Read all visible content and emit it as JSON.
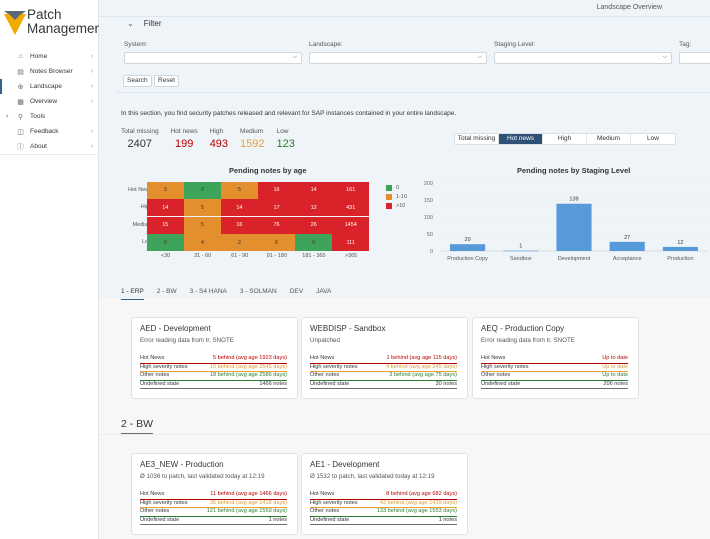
{
  "app": {
    "title_line1": "Patch",
    "title_line2": "Management",
    "brand_colors": {
      "orange": "#f0ab00",
      "dark": "#5e6a73"
    }
  },
  "sidebar": {
    "items": [
      {
        "label": "Home",
        "icon": "home-icon",
        "glyph": "⌂",
        "active": false,
        "expandable": false
      },
      {
        "label": "Notes Browser",
        "icon": "notes-icon",
        "glyph": "▤",
        "active": false,
        "expandable": false
      },
      {
        "label": "Landscape",
        "icon": "globe-icon",
        "glyph": "⊕",
        "active": true,
        "expandable": false
      },
      {
        "label": "Overview",
        "icon": "grid-icon",
        "glyph": "▦",
        "active": false,
        "expandable": false
      },
      {
        "label": "Tools",
        "icon": "wrench-icon",
        "glyph": "⚲",
        "active": false,
        "expandable": true
      },
      {
        "label": "Feedback",
        "icon": "feedback-icon",
        "glyph": "◫",
        "active": false,
        "expandable": false
      },
      {
        "label": "About",
        "icon": "info-icon",
        "glyph": "ⓘ",
        "active": false,
        "expandable": false
      }
    ]
  },
  "header": {
    "title": "Landscape Overview"
  },
  "filter": {
    "title": "Filter",
    "fields": [
      {
        "label": "System:",
        "value": ""
      },
      {
        "label": "Landscape:",
        "value": ""
      },
      {
        "label": "Staging Level:",
        "value": ""
      },
      {
        "label": "Tag:",
        "value": ""
      }
    ],
    "search_label": "Search",
    "reset_label": "Reset"
  },
  "intro": "In this section, you find security patches released and relevant for SAP instances contained in your entire landscape.",
  "kpis": [
    {
      "label": "Total missing",
      "value": "2407",
      "color": "#32363a"
    },
    {
      "label": "Hot news",
      "value": "199",
      "color": "#bb0000"
    },
    {
      "label": "High",
      "value": "493",
      "color": "#bb0000"
    },
    {
      "label": "Medium",
      "value": "1592",
      "color": "#e9a230"
    },
    {
      "label": "Low",
      "value": "123",
      "color": "#2b7d2b"
    }
  ],
  "segmented": {
    "options": [
      "Total missing",
      "Hot news",
      "High",
      "Medium",
      "Low"
    ],
    "selected": "Hot news"
  },
  "chart_data": [
    {
      "type": "heatmap",
      "title": "Pending notes by age",
      "rows": [
        "Hot News",
        "High",
        "Medium",
        "Low"
      ],
      "columns": [
        "<30",
        "31 - 60",
        "61 - 90",
        "91 - 180",
        "181 - 365",
        ">365"
      ],
      "values": [
        [
          3,
          0,
          5,
          16,
          14,
          161
        ],
        [
          14,
          5,
          14,
          17,
          12,
          431
        ],
        [
          15,
          5,
          16,
          76,
          26,
          1454
        ],
        [
          0,
          4,
          2,
          6,
          0,
          111
        ]
      ],
      "legend": [
        {
          "label": "0",
          "color": "#3fa45b"
        },
        {
          "label": "1-10",
          "color": "#e38f2d"
        },
        {
          "label": ">10",
          "color": "#d9222a"
        }
      ],
      "legend_position": "right"
    },
    {
      "type": "bar",
      "title": "Pending notes by Staging Level",
      "categories": [
        "Production Copy",
        "Sandbox",
        "Development",
        "Acceptance",
        "Production"
      ],
      "values": [
        20,
        1,
        139,
        27,
        12
      ],
      "ylim": [
        0,
        200
      ],
      "yticks": [
        0,
        50,
        100,
        150,
        200
      ],
      "xlabel": "",
      "ylabel": "",
      "grid": true,
      "bar_color": "#5899da"
    }
  ],
  "tabs": [
    {
      "label": "1 - ERP",
      "active": true
    },
    {
      "label": "2 - BW",
      "active": false
    },
    {
      "label": "3 - S4 HANA",
      "active": false
    },
    {
      "label": "3 - SOLMAN",
      "active": false
    },
    {
      "label": "DEV",
      "active": false
    },
    {
      "label": "JAVA",
      "active": false
    }
  ],
  "row_labels": {
    "hot": "Hot News",
    "high": "High severity notes",
    "other": "Other notes",
    "undef": "Undefined state"
  },
  "sections": [
    {
      "title": "1 - ERP",
      "cards": [
        {
          "title": "AED - Development",
          "subtitle": "Error reading data from tr. SNOTE",
          "hot": "5 behind (avg age 1923 days)",
          "high": "15 behind (avg age 2545 days)",
          "other": "18 behind (avg age 2586 days)",
          "undef": "1466 notes"
        },
        {
          "title": "WEBDISP - Sandbox",
          "subtitle": "Unpatched",
          "hot": "1 behind (avg age 115 days)",
          "high": "4 behind (avg age 245 days)",
          "other": "3 behind (avg age 75 days)",
          "undef": "30 notes"
        },
        {
          "title": "AEQ - Production Copy",
          "subtitle": "Error reading data from tr. SNOTE",
          "hot": "Up to date",
          "high": "Up to date",
          "other": "Up to date",
          "undef": "206 notes"
        }
      ]
    },
    {
      "title": "2 - BW",
      "cards": [
        {
          "title": "AE3_NEW - Production",
          "subtitle": "Ø 1036 to patch, last validated today at 12:19",
          "hot": "11 behind (avg age 1466 days)",
          "high": "36 behind (avg age 1418 days)",
          "other": "121 behind (avg age 1559 days)",
          "undef": "1 notes"
        },
        {
          "title": "AE1 - Development",
          "subtitle": "Ø 1532 to patch, last validated today at 12:19",
          "hot": "8 behind (avg age 682 days)",
          "high": "42 behind (avg age 1439 days)",
          "other": "133 behind (avg age 1553 days)",
          "undef": "1 notes"
        }
      ]
    }
  ]
}
